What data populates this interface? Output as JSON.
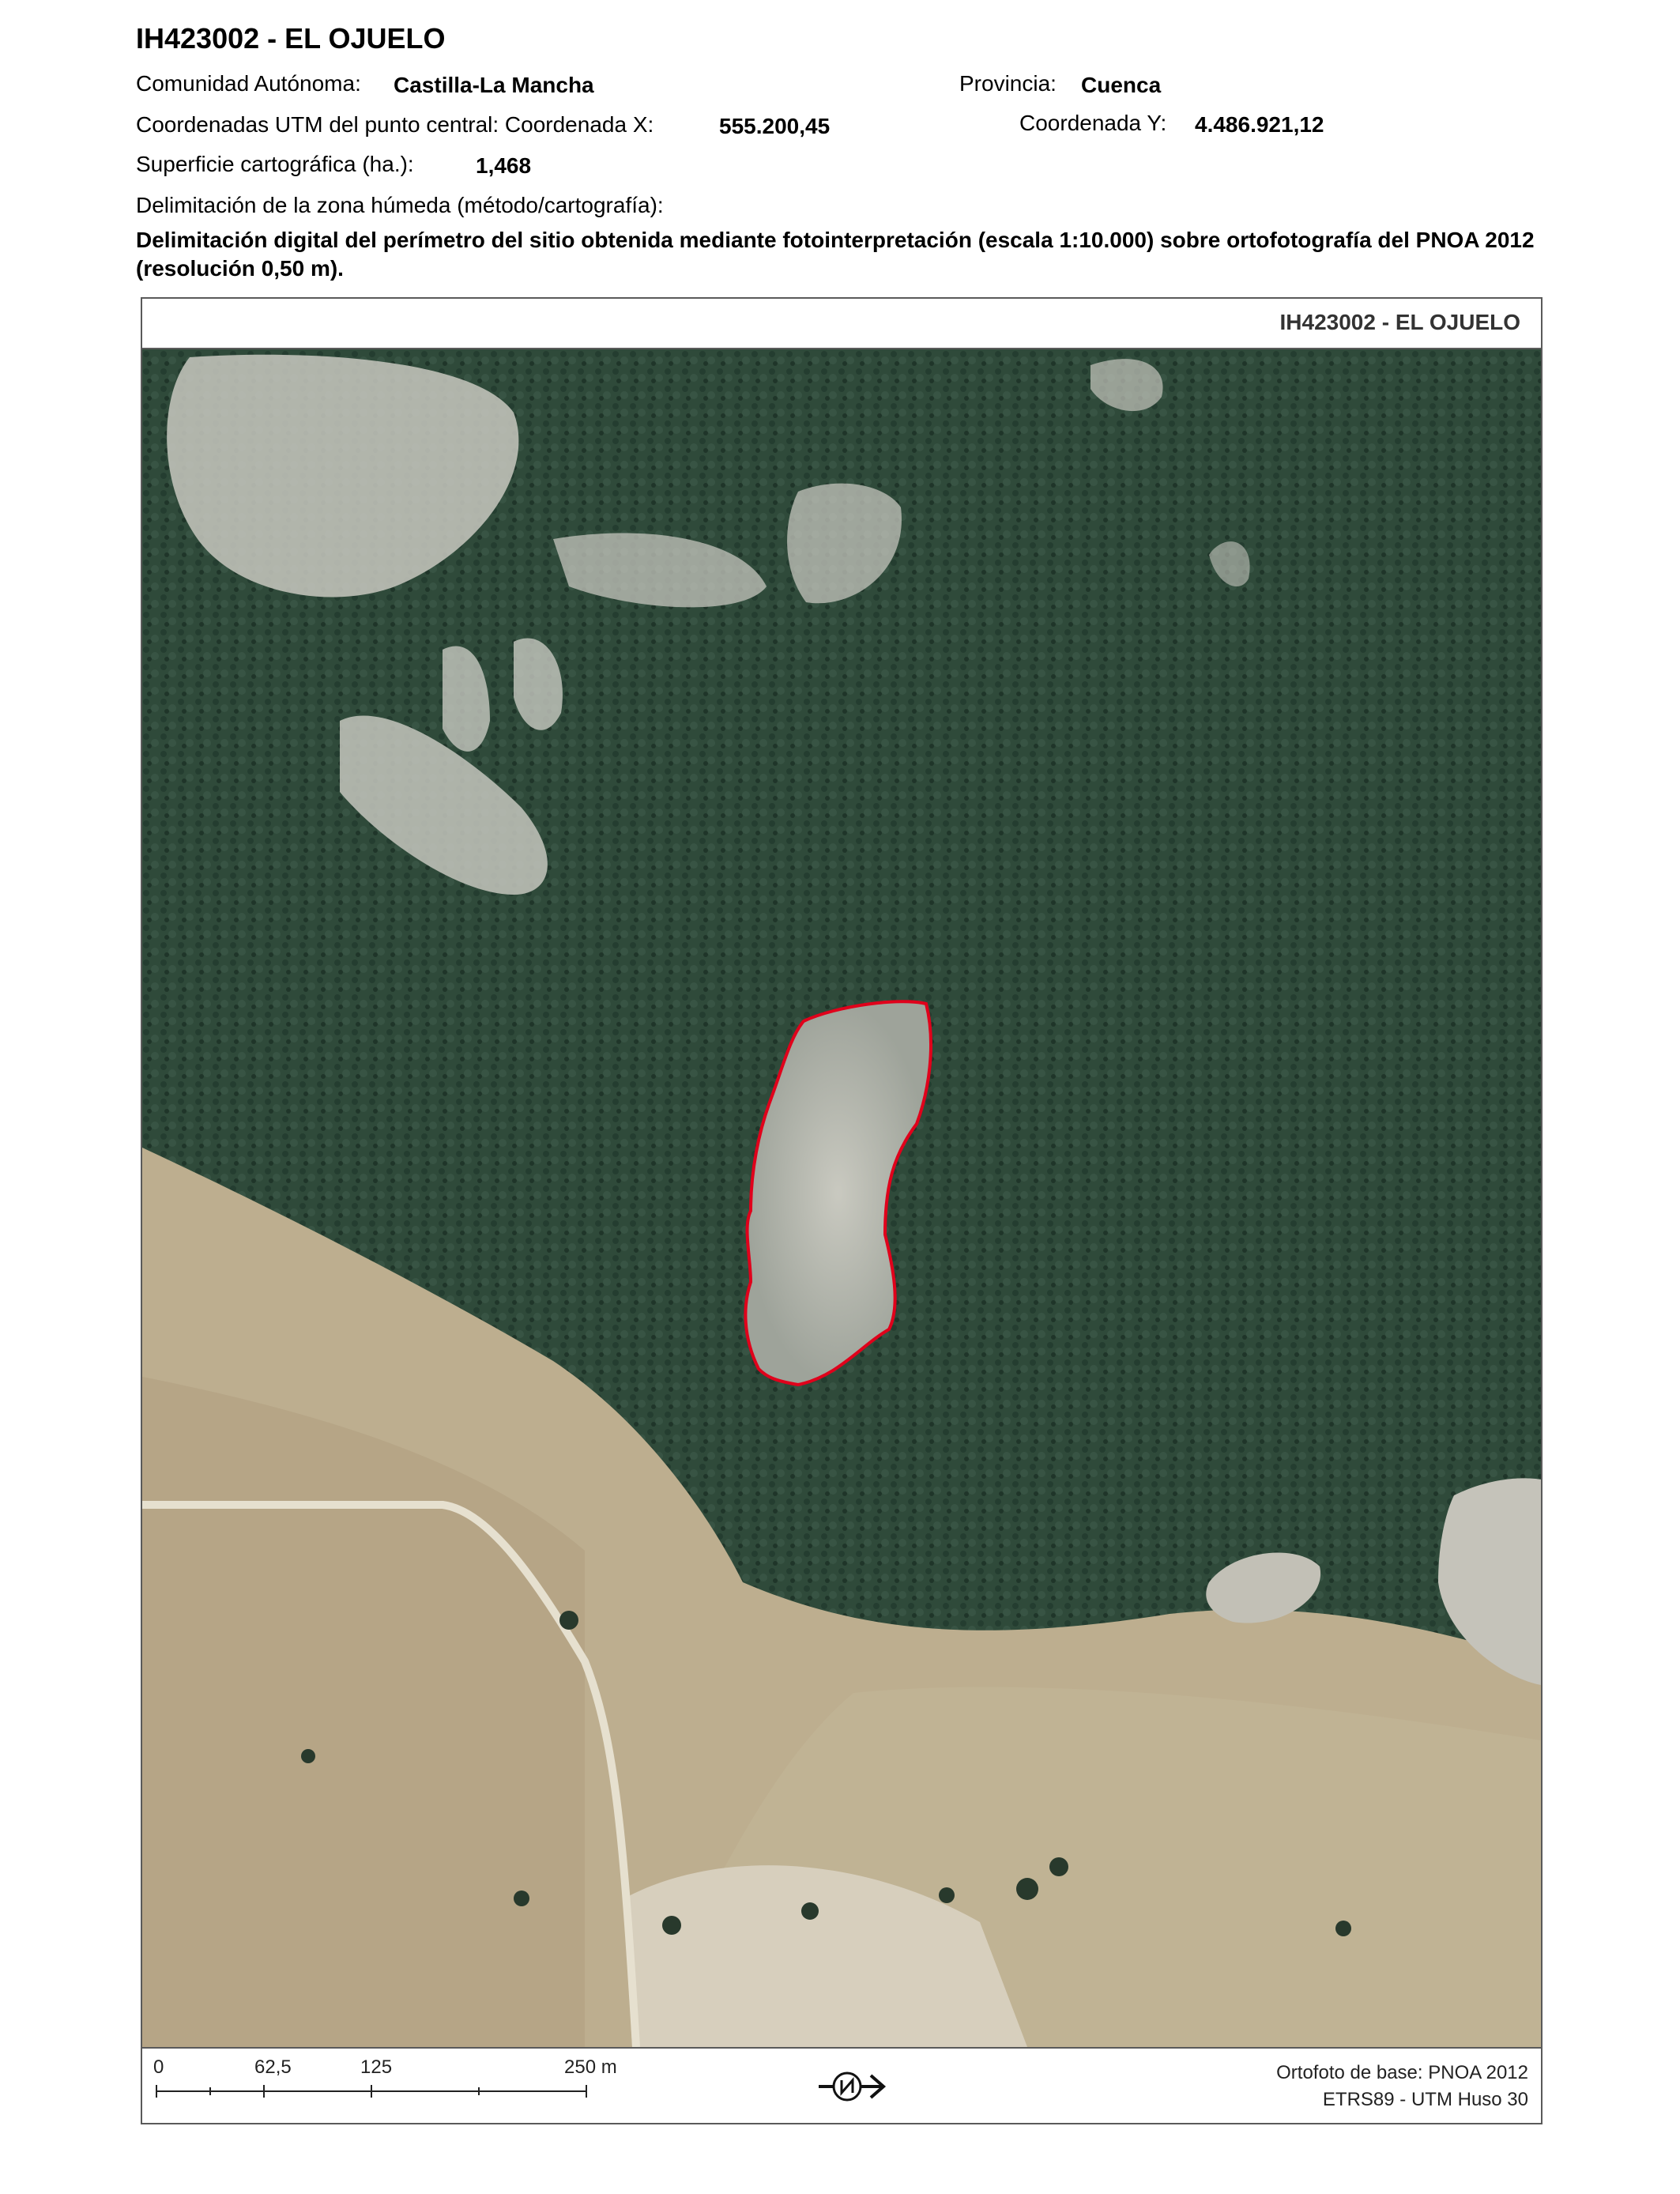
{
  "header": {
    "title": "IH423002 - EL OJUELO",
    "comunidad_label": "Comunidad Autónoma:",
    "comunidad_value": "Castilla-La Mancha",
    "provincia_label": "Provincia:",
    "provincia_value": "Cuenca",
    "coord_x_label": "Coordenadas UTM del punto central: Coordenada X:",
    "coord_x_value": "555.200,45",
    "coord_y_label": "Coordenada Y:",
    "coord_y_value": "4.486.921,12",
    "superficie_label": "Superficie cartográfica (ha.):",
    "superficie_value": "1,468",
    "delimitacion_label": "Delimitación de la zona húmeda (método/cartografía):",
    "delimitacion_value": "Delimitación digital del perímetro del sitio obtenida mediante fotointerpretación (escala 1:10.000) sobre ortofotografía del PNOA 2012 (resolución 0,50 m)."
  },
  "map": {
    "frame_title": "IH423002 - EL OJUELO",
    "boundary_color": "#e0001b",
    "forest_color": "#2f4a3a",
    "field_color": "#b8ab8e",
    "scale": {
      "labels": [
        "0",
        "62,5",
        "125",
        "250 m"
      ]
    },
    "north_arrow_icon": "north-arrow-icon",
    "credits": {
      "line1": "Ortofoto de base: PNOA 2012",
      "line2": "ETRS89 - UTM Huso 30"
    }
  }
}
